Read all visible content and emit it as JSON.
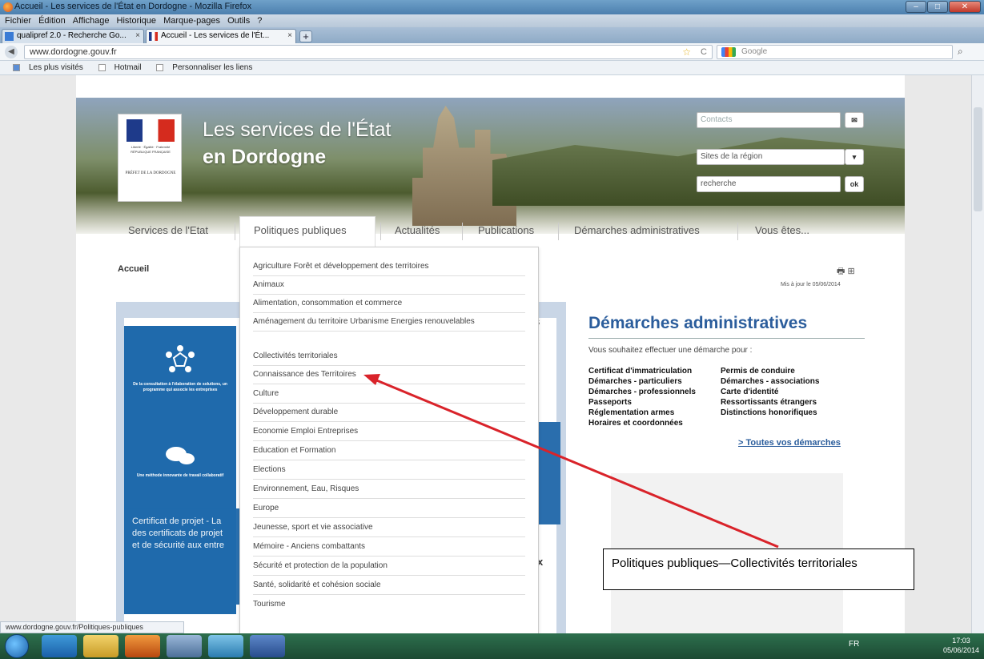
{
  "window": {
    "title": "Accueil - Les services de l'État en Dordogne - Mozilla Firefox",
    "controls": {
      "minimize": "–",
      "maximize": "□",
      "close": "✕"
    }
  },
  "menubar": [
    "Fichier",
    "Édition",
    "Affichage",
    "Historique",
    "Marque-pages",
    "Outils",
    "?"
  ],
  "tabs": [
    {
      "label": "qualipref 2.0 - Recherche Go...",
      "close": "×",
      "icon": "page-icon"
    },
    {
      "label": "Accueil - Les services de l'Ét...",
      "close": "×",
      "icon": "marianne-icon"
    }
  ],
  "new_tab": "+",
  "navbar": {
    "url": "www.dordogne.gouv.fr",
    "search_placeholder": "Google",
    "star": "☆",
    "reload": "C",
    "menu_icons": "⌕ ⌂ ✎"
  },
  "bookmarks": [
    "Les plus visités",
    "Hotmail",
    "Personnaliser les liens"
  ],
  "site": {
    "logo_rf": "Liberté · Égalité · Fraternité RÉPUBLIQUE FRANÇAISE",
    "logo_prefet": "PRÉFET DE LA DORDOGNE",
    "title_line1": "Les services de l'État",
    "title_line2": "en Dordogne",
    "contacts_placeholder": "Contacts",
    "contacts_icon": "✉",
    "region_select": "Sites de la région",
    "region_arrow": "▾",
    "search_placeholder": "recherche",
    "search_button": "ok"
  },
  "mainnav": [
    "Services de l'Etat",
    "Politiques publiques",
    "Actualités",
    "Publications",
    "Démarches administratives",
    "Vous êtes..."
  ],
  "breadcrumb": "Accueil",
  "print_icons": "🖶 ⊞",
  "updated": "Mis à jour le 05/06/2014",
  "dropdown": [
    "Agriculture Forêt et développement des territoires",
    "Animaux",
    "Alimentation, consommation et commerce",
    "Aménagement du territoire Urbanisme Energies renouvelables",
    "Collectivités territoriales",
    "Connaissance des Territoires",
    "Culture",
    "Développement durable",
    "Economie Emploi Entreprises",
    "Education et Formation",
    "Elections",
    "Environnement, Eau, Risques",
    "Europe",
    "Jeunesse, sport et vie associative",
    "Mémoire - Anciens combattants",
    "Sécurité et protection de la population",
    "Santé, solidarité et cohésion sociale",
    "Tourisme"
  ],
  "blue_card": {
    "text1": "De la consultation à l'élaboration de solutions, un programme qui associe les entreprises",
    "text2": "Une méthode innovante de travail collaboratif"
  },
  "cert": [
    "Certificat de projet - La",
    "des certificats de projet",
    "et de sécurité aux entre"
  ],
  "peek": {
    "s": "s",
    "l": "l",
    "ux": "ux"
  },
  "demarches": {
    "title": "Démarches administratives",
    "subtitle": "Vous souhaitez effectuer une démarche pour :",
    "links_left": [
      "Certificat d'immatriculation",
      "Démarches - particuliers",
      "Démarches - professionnels",
      "Passeports",
      "Réglementation armes",
      "Horaires et coordonnées"
    ],
    "links_right": [
      "Permis de conduire",
      "Démarches - associations",
      "Carte d'identité",
      "Ressortissants étrangers",
      "Distinctions honorifiques"
    ],
    "all": "> Toutes vos démarches"
  },
  "annotation": "Politiques publiques—Collectivités  territoriales",
  "annotation_arrow_color": "#d9232a",
  "statusbar": "www.dordogne.gouv.fr/Politiques-publiques",
  "taskbar": {
    "lang": "FR",
    "time": "17:03",
    "date": "05/06/2014"
  }
}
